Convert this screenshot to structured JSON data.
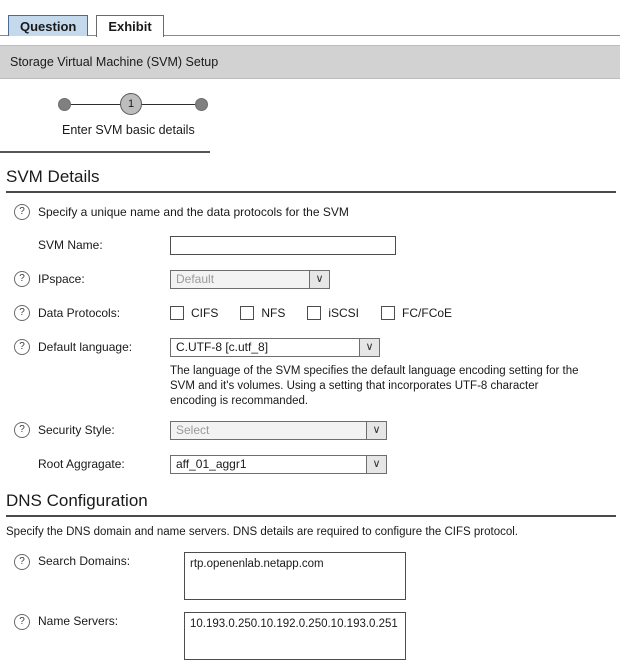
{
  "tabs": [
    {
      "label": "Question",
      "active": false
    },
    {
      "label": "Exhibit",
      "active": true
    }
  ],
  "titlebar": {
    "title": "Storage Virtual Machine (SVM) Setup"
  },
  "stepper": {
    "current_step": "1",
    "label": "Enter SVM basic details"
  },
  "svm_details": {
    "heading": "SVM Details",
    "intro": "Specify a unique name and the data protocols for the SVM",
    "svm_name": {
      "label": "SVM Name:",
      "value": "",
      "placeholder": ""
    },
    "ipspace": {
      "label": "IPspace:",
      "value": "Default",
      "arrow": "∨"
    },
    "data_protocols": {
      "label": "Data Protocols:",
      "options": [
        {
          "label": "CIFS",
          "checked": false
        },
        {
          "label": "NFS",
          "checked": false
        },
        {
          "label": "iSCSI",
          "checked": false
        },
        {
          "label": "FC/FCoE",
          "checked": false
        }
      ]
    },
    "default_language": {
      "label": "Default language:",
      "value": "C.UTF-8 [c.utf_8]",
      "arrow": "∨",
      "help": "The language of the SVM specifies the default language encoding setting for the SVM and it's volumes. Using a setting that incorporates UTF-8 character encoding is recommanded."
    },
    "security_style": {
      "label": "Security Style:",
      "value": "Select",
      "arrow": "∨"
    },
    "root_aggregate": {
      "label": "Root Aggragate:",
      "value": "aff_01_aggr1",
      "arrow": "∨"
    }
  },
  "dns_configuration": {
    "heading": "DNS Configuration",
    "note": "Specify the DNS domain and name servers. DNS details are required to configure the CIFS protocol.",
    "search_domains": {
      "label": "Search Domains:",
      "value": "rtp.openenlab.netapp.com"
    },
    "name_servers": {
      "label": "Name Servers:",
      "value": "10.193.0.250.10.192.0.250.10.193.0.251"
    }
  },
  "icons": {
    "help": "?"
  }
}
